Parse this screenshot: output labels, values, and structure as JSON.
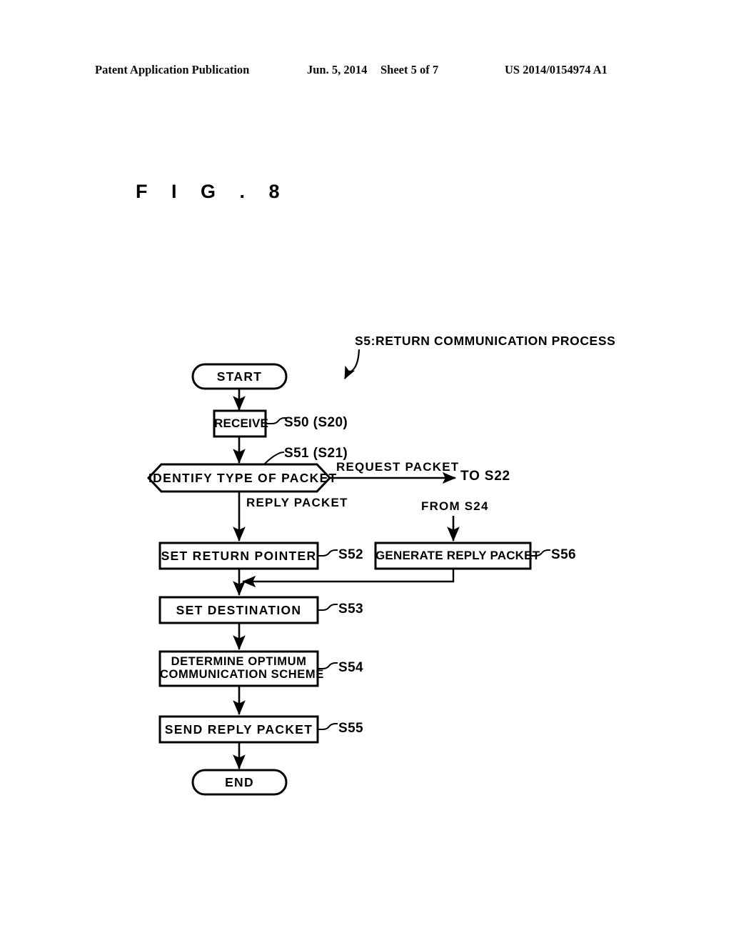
{
  "header": {
    "publication": "Patent Application Publication",
    "date": "Jun. 5, 2014",
    "sheet": "Sheet 5 of 7",
    "patent_number": "US 2014/0154974 A1"
  },
  "figure": {
    "title": "F I G .  8",
    "annotation": "S5:RETURN COMMUNICATION PROCESS"
  },
  "nodes": {
    "start": "START",
    "receive": "RECEIVE",
    "identify": "IDENTIFY TYPE OF PACKET",
    "set_return_pointer": "SET RETURN POINTER",
    "generate_reply_packet": "GENERATE REPLY PACKET",
    "set_destination": "SET DESTINATION",
    "determine_line1": "DETERMINE OPTIMUM",
    "determine_line2": "COMMUNICATION SCHEME",
    "send_reply_packet": "SEND REPLY PACKET",
    "end": "END"
  },
  "step_ids": {
    "receive": "S50 (S20)",
    "identify": "S51 (S21)",
    "set_return_pointer": "S52",
    "generate_reply_packet": "S56",
    "set_destination": "S53",
    "determine_optimum": "S54",
    "send_reply_packet": "S55"
  },
  "edge_labels": {
    "request_packet": "REQUEST PACKET",
    "reply_packet": "REPLY PACKET",
    "to_s22": "TO S22",
    "from_s24": "FROM S24"
  },
  "colors": {
    "ink": "#000000",
    "paper": "#ffffff"
  }
}
